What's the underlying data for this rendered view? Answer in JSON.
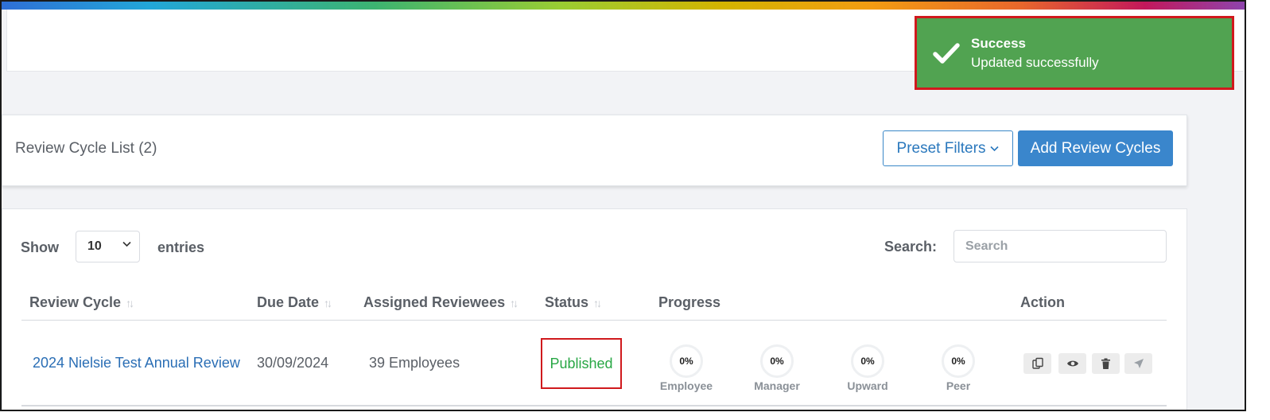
{
  "toast": {
    "title": "Success",
    "message": "Updated successfully",
    "icon": "check-icon",
    "color": "#51a351"
  },
  "header": {
    "title": "Review Cycle List (2)",
    "preset_filters_label": "Preset Filters",
    "add_button_label": "Add Review Cycles"
  },
  "table_controls": {
    "show_label": "Show",
    "page_length": "10",
    "entries_label": "entries",
    "search_label": "Search:",
    "search_placeholder": "Search",
    "search_value": ""
  },
  "columns": [
    "Review Cycle",
    "Due Date",
    "Assigned Reviewees",
    "Status",
    "Progress",
    "Action"
  ],
  "rows": [
    {
      "review_cycle": "2024 Nielsie Test Annual Review",
      "due_date": "30/09/2024",
      "assigned": "39 Employees",
      "status": "Published",
      "progress": [
        {
          "label": "Employee",
          "value": "0%"
        },
        {
          "label": "Manager",
          "value": "0%"
        },
        {
          "label": "Upward",
          "value": "0%"
        },
        {
          "label": "Peer",
          "value": "0%"
        }
      ],
      "actions": [
        "copy-icon",
        "eye-icon",
        "trash-icon",
        "rocket-icon"
      ]
    }
  ]
}
